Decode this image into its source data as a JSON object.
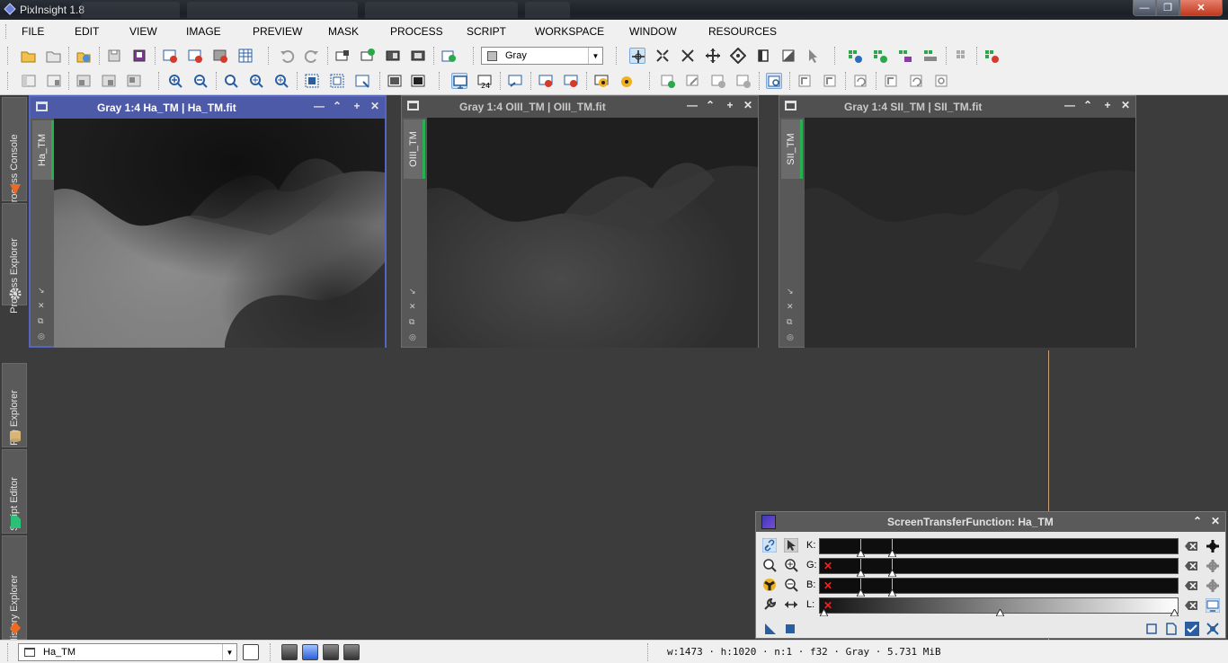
{
  "app": {
    "title": "PixInsight 1.8"
  },
  "window_controls": {
    "minimize": "—",
    "maximize": "❐",
    "close": "✕"
  },
  "menu": [
    "FILE",
    "EDIT",
    "VIEW",
    "IMAGE",
    "PREVIEW",
    "MASK",
    "PROCESS",
    "SCRIPT",
    "WORKSPACE",
    "WINDOW",
    "RESOURCES"
  ],
  "toolbar": {
    "color_space_select": "Gray"
  },
  "sidebar": {
    "tabs": [
      "Process Console",
      "Process Explorer",
      "File Explorer",
      "Script Editor",
      "History Explorer"
    ]
  },
  "image_windows": [
    {
      "title": "Gray 1:4 Ha_TM | Ha_TM.fit",
      "view_id": "Ha_TM",
      "active": true
    },
    {
      "title": "Gray 1:4 OIII_TM | OIII_TM.fit",
      "view_id": "OIII_TM",
      "active": false
    },
    {
      "title": "Gray 1:4 SII_TM | SII_TM.fit",
      "view_id": "SII_TM",
      "active": false
    }
  ],
  "stf": {
    "title": "ScreenTransferFunction: Ha_TM",
    "rows": [
      {
        "label": "K:",
        "disabled_x": false
      },
      {
        "label": "G:",
        "disabled_x": true
      },
      {
        "label": "B:",
        "disabled_x": true
      },
      {
        "label": "L:",
        "disabled_x": true
      }
    ]
  },
  "status": {
    "view": "Ha_TM",
    "info": "w:1473 · h:1020 · n:1 · f32 · Gray · 5.731 MiB"
  },
  "colors": {
    "active_window_title": "#4d5aa8",
    "view_tab_accent": "#27b04f",
    "workspace_bg": "#3c3c3c"
  }
}
